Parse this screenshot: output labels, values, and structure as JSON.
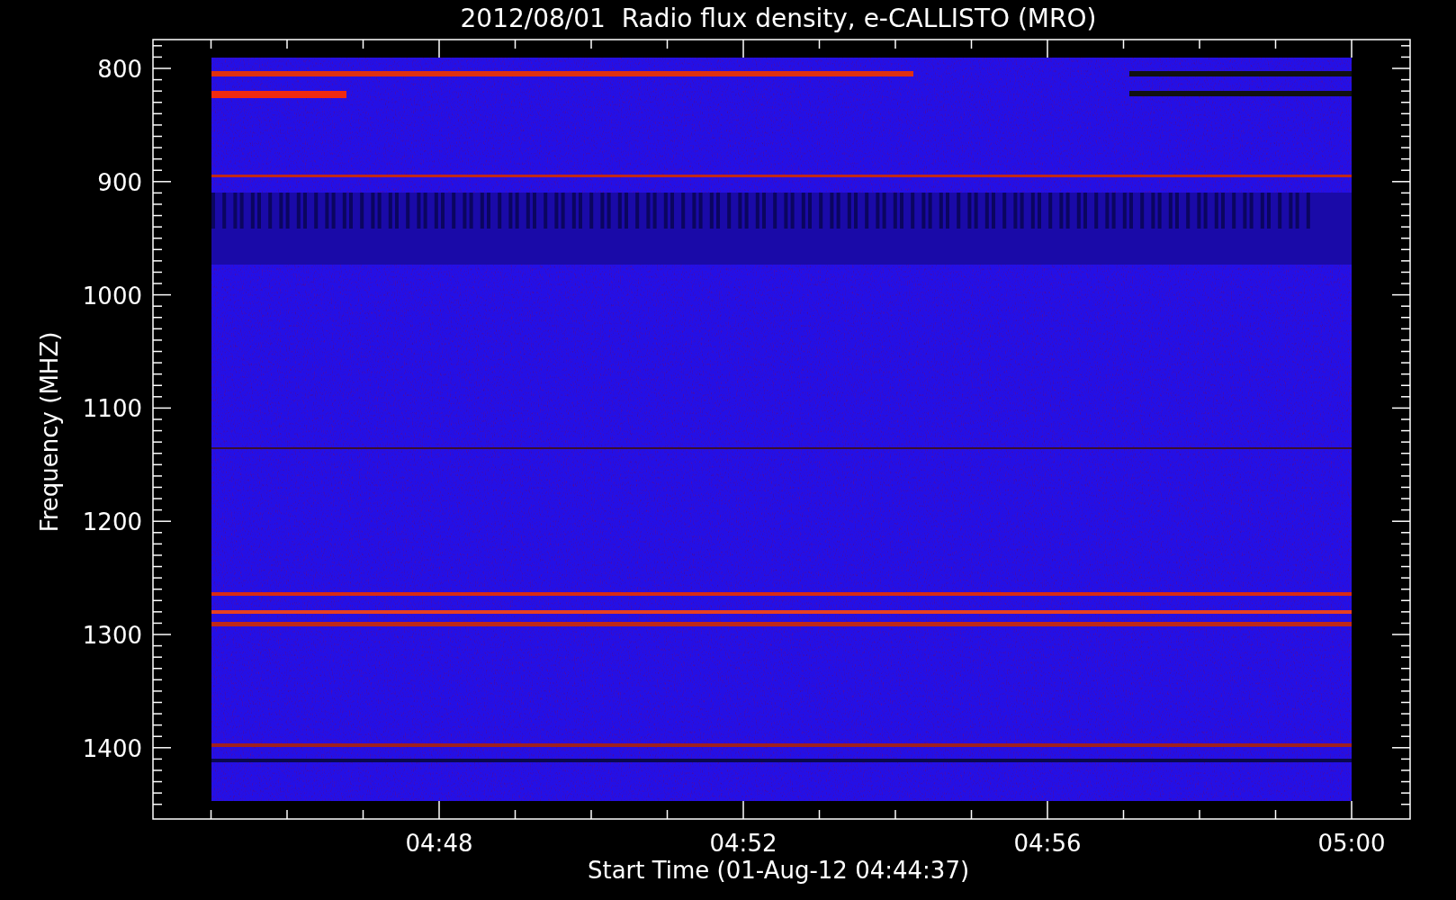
{
  "title": "2012/08/01  Radio flux density, e-CALLISTO (MRO)",
  "y_axis": {
    "label": "Frequency (MHZ)",
    "ticks": [
      "800",
      "900",
      "1000",
      "1100",
      "1200",
      "1300",
      "1400"
    ]
  },
  "x_axis": {
    "label": "Start Time (01-Aug-12 04:44:37)",
    "ticks": [
      "04:48",
      "04:52",
      "04:56",
      "05:00"
    ]
  }
}
